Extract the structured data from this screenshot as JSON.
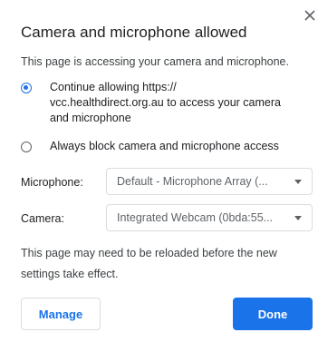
{
  "dialog": {
    "title": "Camera and microphone allowed",
    "subtitle": "This page is accessing your camera and microphone.",
    "close_icon": "close-icon"
  },
  "options": [
    {
      "lines": [
        "Continue allowing https://",
        "vcc.healthdirect.org.au to access your camera",
        "and microphone"
      ],
      "checked": true
    },
    {
      "lines": [
        "Always block camera and microphone access"
      ],
      "checked": false
    }
  ],
  "devices": {
    "microphone_label": "Microphone:",
    "microphone_value": "Default - Microphone Array (...",
    "camera_label": "Camera:",
    "camera_value": "Integrated Webcam (0bda:55..."
  },
  "note": {
    "lines": [
      "This page may need to be reloaded before the new",
      "settings take effect."
    ]
  },
  "buttons": {
    "manage": "Manage",
    "done": "Done"
  },
  "colors": {
    "accent": "#1a73e8",
    "text": "#202124",
    "border": "#dadce0"
  }
}
